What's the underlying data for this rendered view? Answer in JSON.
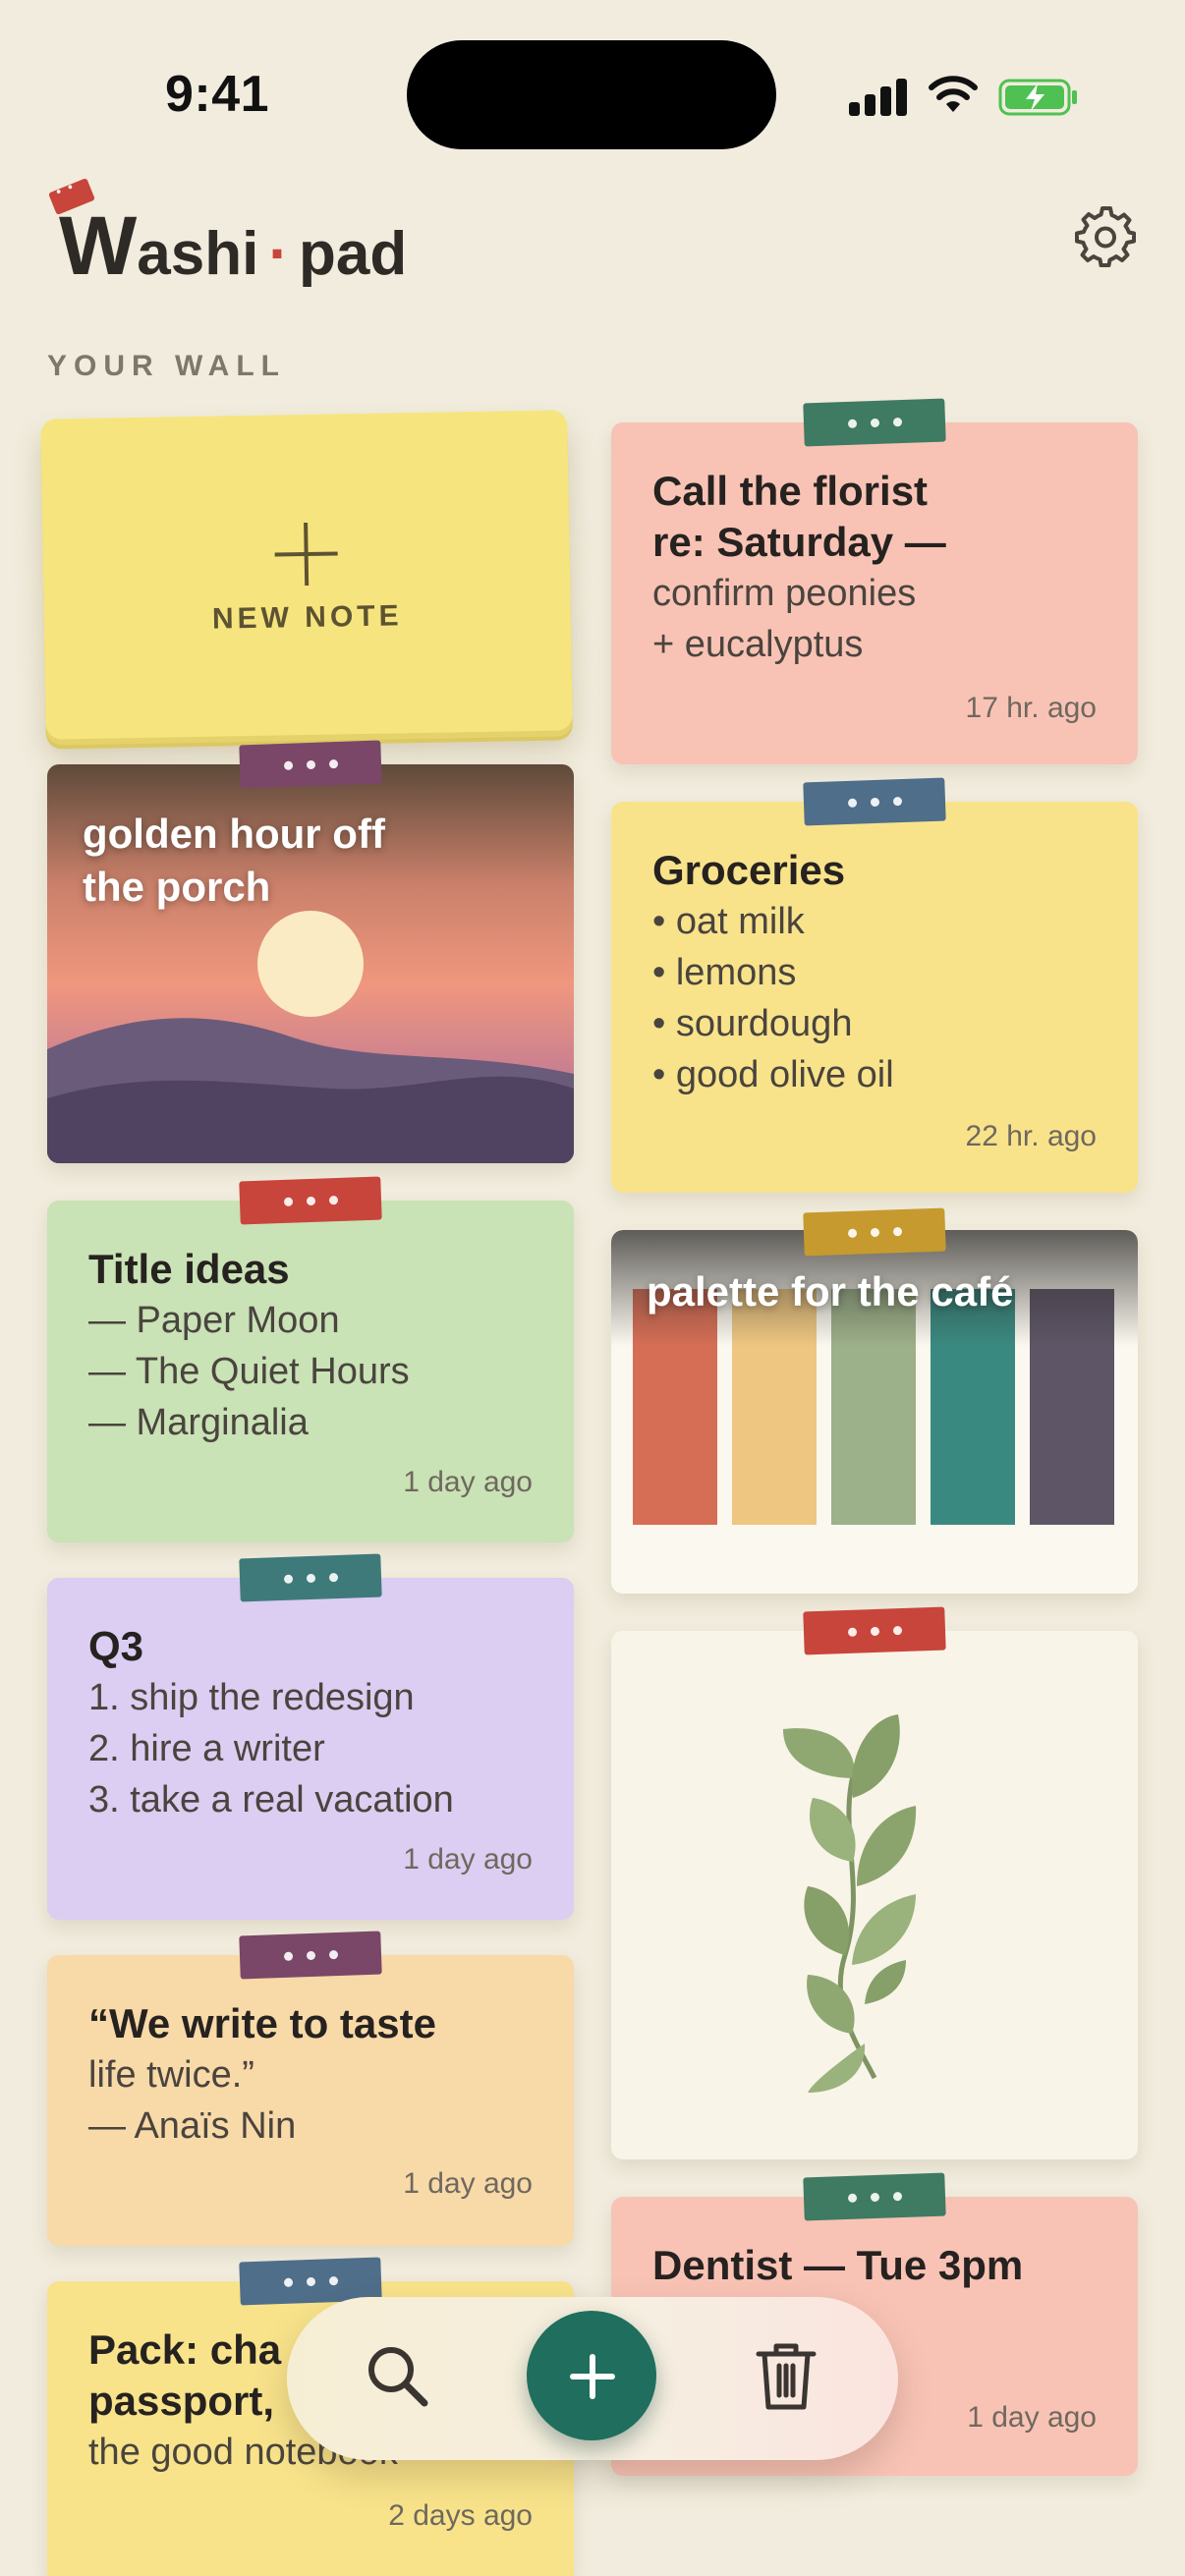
{
  "status": {
    "time": "9:41"
  },
  "header": {
    "logo_w": "W",
    "logo_rest": "ashi",
    "logo_dot": "·",
    "logo_pad": "pad",
    "settings_icon": "gear-icon"
  },
  "section_label": "YOUR WALL",
  "new_note": {
    "label": "NEW NOTE"
  },
  "notes": {
    "florist": {
      "title": [
        "Call the florist",
        "re: Saturday —"
      ],
      "lines": [
        "confirm peonies",
        "+ eucalyptus"
      ],
      "time": "17 hr. ago",
      "bg": "#F8C3B5",
      "tape": "#3F7A62"
    },
    "sunset": {
      "title": [
        "golden hour off",
        "the porch"
      ],
      "tape": "#7A4768"
    },
    "groceries": {
      "title": "Groceries",
      "lines": [
        "• oat milk",
        "• lemons",
        "• sourdough",
        "• good olive oil"
      ],
      "time": "22 hr. ago",
      "bg": "#F8E38B",
      "tape": "#4E6E8A"
    },
    "titles": {
      "title": "Title ideas",
      "lines": [
        "— Paper Moon",
        "— The Quiet Hours",
        "— Marginalia"
      ],
      "time": "1 day ago",
      "bg": "#C9E2B6",
      "tape": "#C8453B"
    },
    "palette": {
      "title": "palette for the café",
      "tape": "#C69A2E",
      "colors": [
        "#D66E55",
        "#EEC681",
        "#9CB089",
        "#3A8980",
        "#5E5566"
      ]
    },
    "q3": {
      "title": "Q3",
      "lines": [
        "1. ship the redesign",
        "2. hire a writer",
        "3. take a real vacation"
      ],
      "time": "1 day ago",
      "bg": "#DCCDF2",
      "tape": "#3F7A7A"
    },
    "leaf": {
      "tape": "#C8453B"
    },
    "quote": {
      "title": "“We write to taste",
      "lines": [
        "life twice.”",
        "— Anaïs Nin"
      ],
      "time": "1 day ago",
      "bg": "#F8D9A8",
      "tape": "#7A4768"
    },
    "dentist": {
      "title": "Dentist — Tue 3pm",
      "time": "1 day ago",
      "bg": "#F8C3B5",
      "tape": "#3F7A62"
    },
    "pack": {
      "title": [
        "Pack: cha",
        "passport,"
      ],
      "lines": [
        "the good notebook"
      ],
      "time": "2 days ago",
      "bg": "#F8E38B",
      "tape": "#4E6E8A"
    }
  },
  "dock": {
    "search_icon": "search-icon",
    "add_icon": "plus-icon",
    "trash_icon": "trash-icon"
  }
}
